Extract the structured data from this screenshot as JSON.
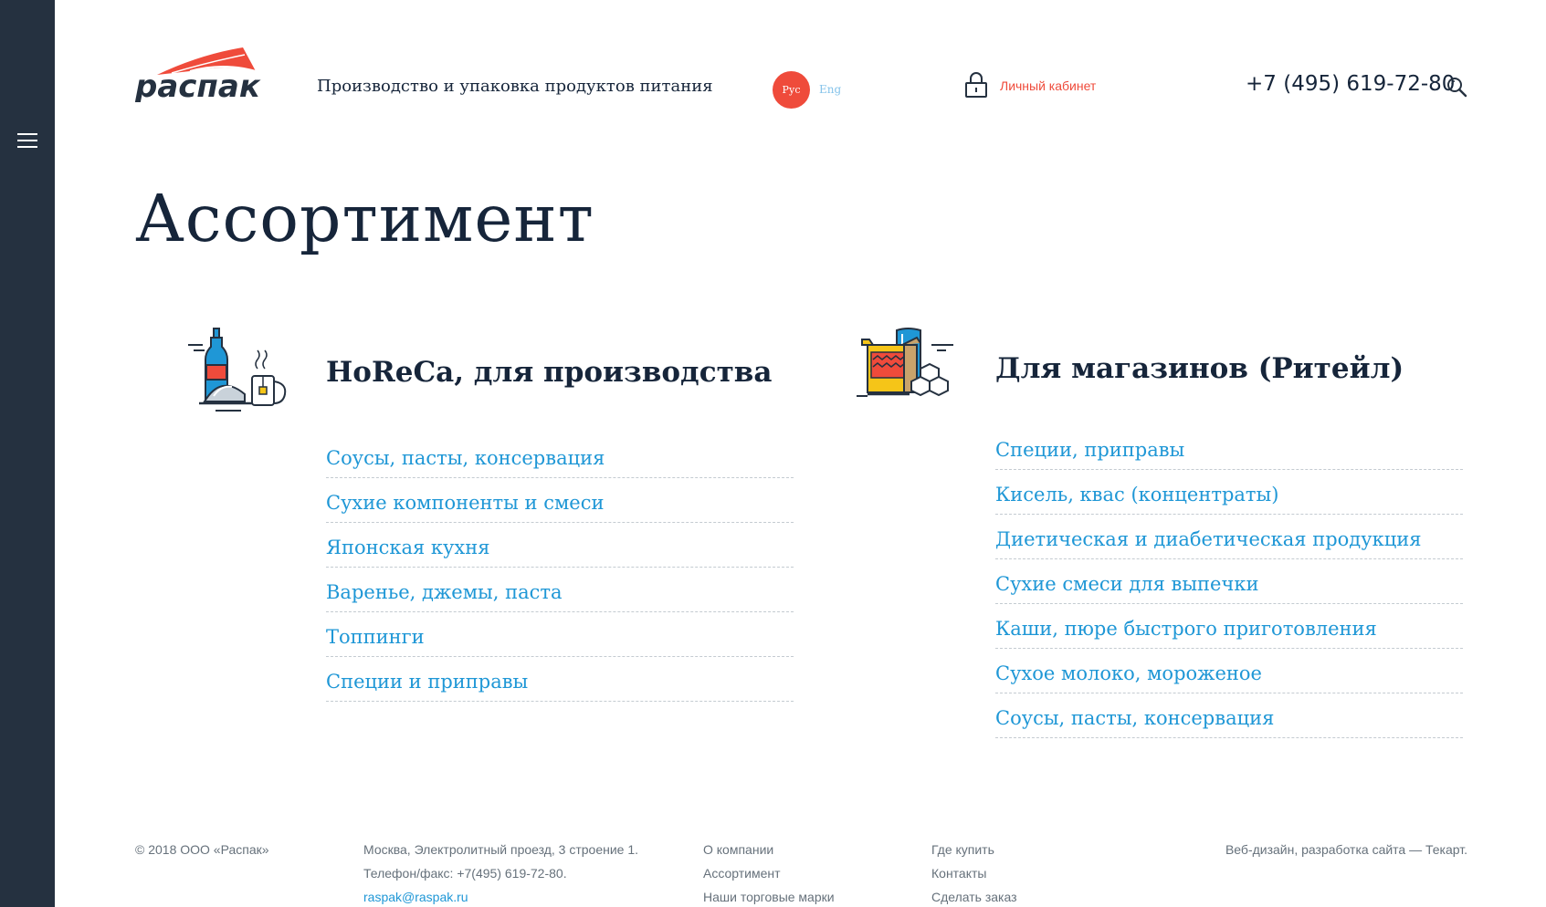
{
  "header": {
    "tagline": "Производство и упаковка продуктов питания",
    "lang_ru": "Рус",
    "lang_en": "Eng",
    "cabinet": "Личный кабинет",
    "phone": "+7 (495) 619-72-80"
  },
  "page_title": "Ассортимент",
  "categories": [
    {
      "title": "HoReCa, для производства",
      "icon": "horeca-icon",
      "items": [
        "Соусы, пасты, консервация",
        "Сухие компоненты и смеси",
        "Японская кухня",
        "Варенье, джемы, паста",
        "Топпинги",
        "Специи и приправы"
      ]
    },
    {
      "title": "Для магазинов (Ритейл)",
      "icon": "retail-icon",
      "items": [
        "Специи, приправы",
        "Кисель, квас (концентраты)",
        "Диетическая и диабетическая продукция",
        "Сухие смеси для выпечки",
        "Каши, пюре быстрого приготовления",
        "Сухое молоко, мороженое",
        "Соусы, пасты, консервация"
      ]
    }
  ],
  "footer": {
    "copyright": "© 2018 ООО «Распак»",
    "address": "Москва, Электролитный проезд, 3 строение 1.",
    "phone_fax": "Телефон/факс: +7(495) 619-72-80.",
    "email": "raspak@raspak.ru",
    "links_col1": [
      "О компании",
      "Ассортимент",
      "Наши торговые марки"
    ],
    "links_col2": [
      "Где купить",
      "Контакты",
      "Сделать заказ"
    ],
    "credit": "Веб-дизайн, разработка сайта — Текарт."
  },
  "colors": {
    "sidebar": "#253140",
    "accent_red": "#ef4b3b",
    "link_blue": "#1f97d6",
    "text_dark": "#16253a"
  }
}
